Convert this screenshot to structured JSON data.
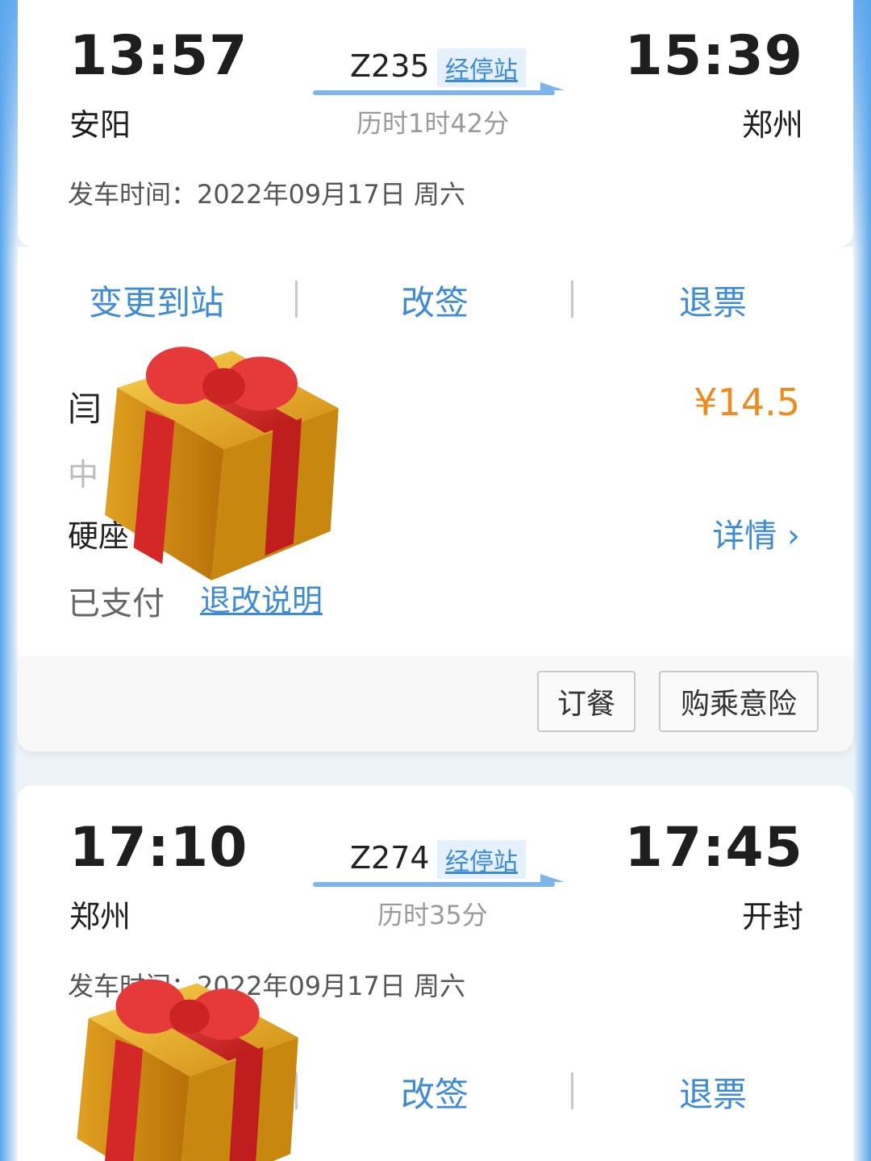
{
  "trip1": {
    "depart_time": "13:57",
    "depart_city": "安阳",
    "train_no": "Z235",
    "stops_label": "经停站",
    "duration": "历时1时42分",
    "arrive_time": "15:39",
    "arrive_city": "郑州",
    "depart_date_line": "发车时间：2022年09月17日 周六",
    "actions": [
      "变更到站",
      "改签",
      "退票"
    ],
    "passenger_name": "闫",
    "ticket_type": "中",
    "seat_type": "硬座",
    "price": "¥14.5",
    "details_label": "详情 ›",
    "pay_status": "已支付",
    "rules_link": "退改说明",
    "buttons": [
      "订餐",
      "购乘意险"
    ]
  },
  "trip2": {
    "depart_time": "17:10",
    "depart_city": "郑州",
    "train_no": "Z274",
    "stops_label": "经停站",
    "duration": "历时35分",
    "arrive_time": "17:45",
    "arrive_city": "开封",
    "depart_date_line": "发车时间：2022年09月17日 周六",
    "actions": [
      "改签",
      "退票"
    ]
  },
  "colors": {
    "accent": "#3c8ad8",
    "price": "#f08a1c",
    "gift_box": "#e8a818",
    "gift_ribbon": "#d92a2a"
  },
  "icons": [
    "gift-emoji-icon",
    "chevron-right-icon",
    "route-arrow-icon"
  ]
}
